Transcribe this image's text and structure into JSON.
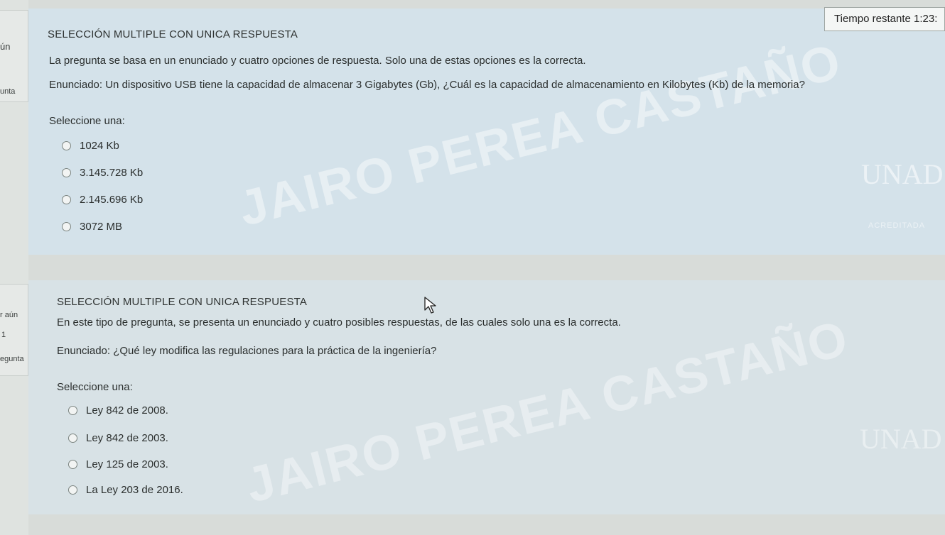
{
  "timer": {
    "text": "Tiempo restante 1:23:"
  },
  "sidebar": {
    "q1_status": "ún",
    "q1_label": "unta",
    "q2_status": "r aún",
    "q2_number": "1",
    "q2_label": "egunta"
  },
  "questions": [
    {
      "type": "SELECCIÓN MULTIPLE CON UNICA RESPUESTA",
      "instructions": "La pregunta se basa en un enunciado y cuatro opciones de respuesta. Solo una de estas opciones es la correcta.",
      "statement": "Enunciado: Un dispositivo USB tiene la capacidad de almacenar 3 Gigabytes (Gb), ¿Cuál es la capacidad de almacenamiento en Kilobytes (Kb) de la memoria?",
      "prompt": "Seleccione una:",
      "options": [
        "1024 Kb",
        "3.145.728 Kb",
        "2.145.696 Kb",
        "3072 MB"
      ]
    },
    {
      "type": "SELECCIÓN MULTIPLE CON UNICA RESPUESTA",
      "instructions": "En este tipo de pregunta, se presenta un enunciado y cuatro posibles respuestas, de las cuales solo una es la correcta.",
      "statement": "Enunciado: ¿Qué ley modifica las regulaciones para la práctica de la ingeniería?",
      "prompt": "Seleccione una:",
      "options": [
        "Ley 842 de 2008.",
        "Ley 842 de 2003.",
        "Ley 125 de 2003.",
        "La Ley 203 de 2016."
      ]
    }
  ],
  "watermark": {
    "text": "JAIRO PEREA CASTAÑO"
  },
  "logo": {
    "text": "UNAD",
    "sub": "ACREDITADA"
  },
  "colors": {
    "panel": "#d4e2ea",
    "background": "#d8dcd9",
    "text": "#2a2e2d"
  }
}
